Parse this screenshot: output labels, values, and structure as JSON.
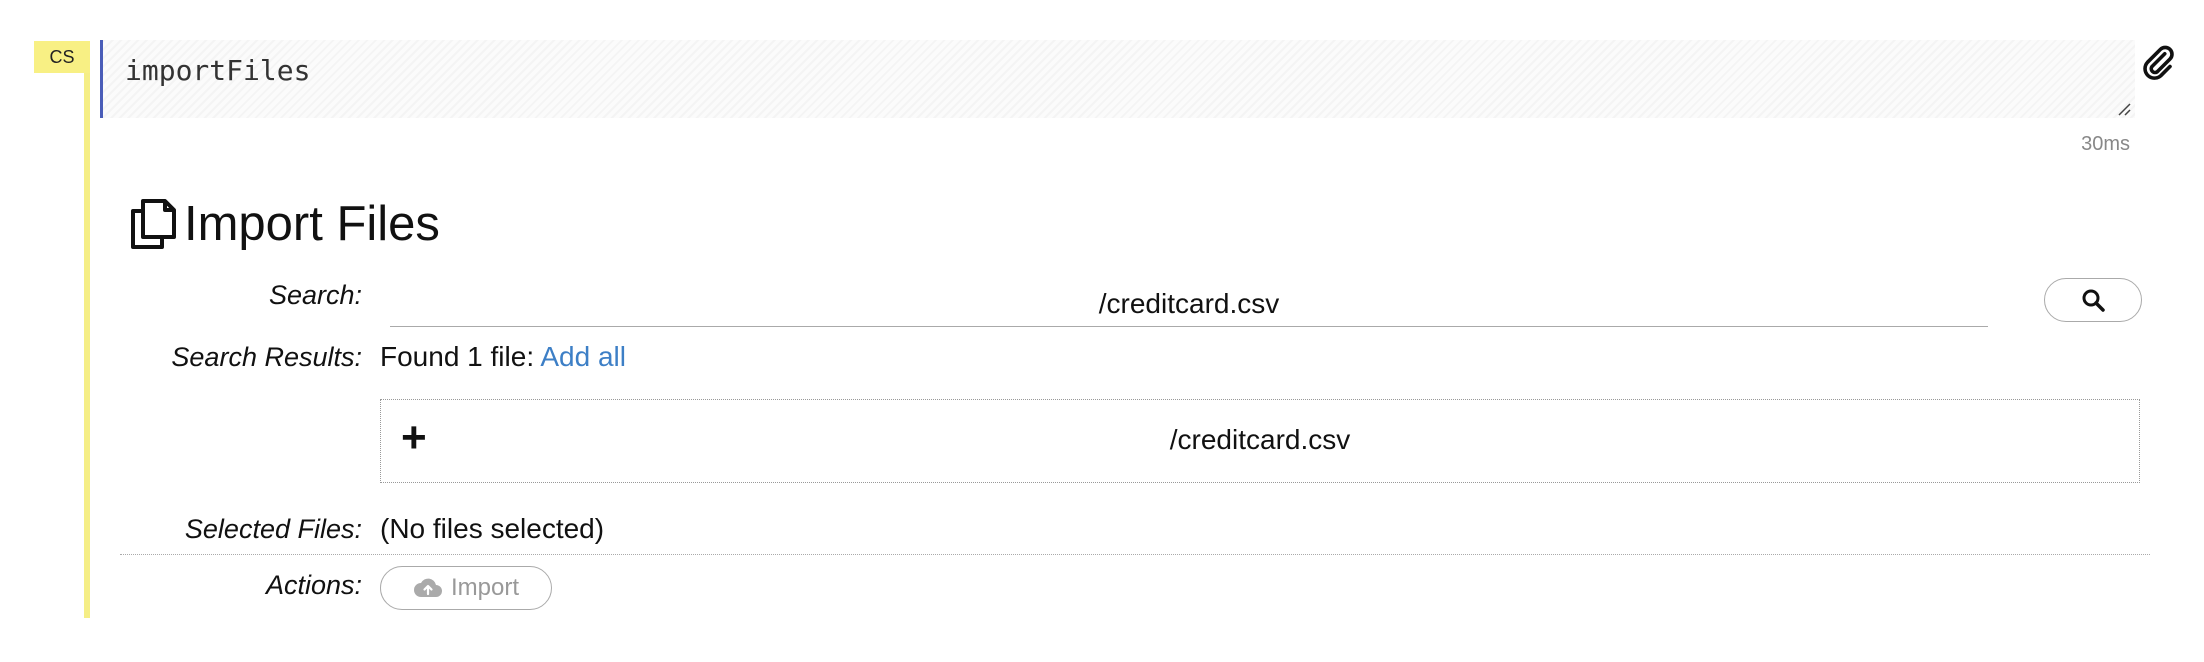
{
  "cell": {
    "type_badge": "CS",
    "code": "importFiles",
    "timing": "30ms"
  },
  "heading": {
    "title": "Import Files",
    "icon": "files-icon"
  },
  "search": {
    "label": "Search:",
    "value": "/creditcard.csv",
    "button_icon": "search-icon"
  },
  "results": {
    "label": "Search Results:",
    "summary": "Found 1 file:",
    "add_all": "Add all",
    "files": [
      {
        "icon": "plus-icon",
        "path": "/creditcard.csv"
      }
    ]
  },
  "selected": {
    "label": "Selected Files:",
    "value": "(No files selected)"
  },
  "actions": {
    "label": "Actions:",
    "import_label": "Import",
    "import_icon": "cloud-upload-icon"
  },
  "colors": {
    "badge": "#f8f084",
    "editor_border": "#4a5db8",
    "link": "#3d7fc6"
  }
}
